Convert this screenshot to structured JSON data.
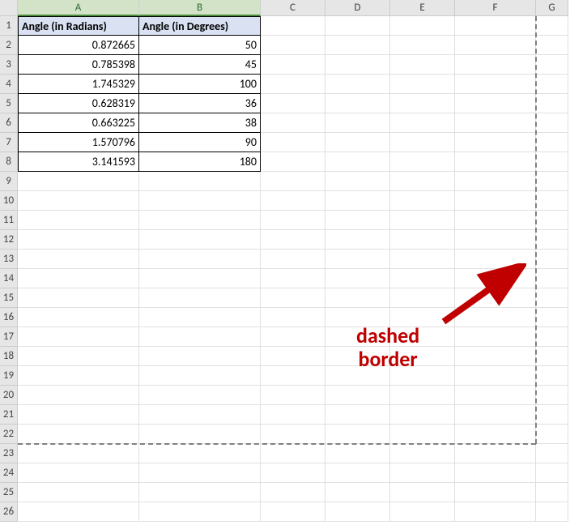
{
  "columns": [
    "A",
    "B",
    "C",
    "D",
    "E",
    "F",
    "G"
  ],
  "selectedCols": [
    "A",
    "B"
  ],
  "headerRow": {
    "A": "Angle (in Radians)",
    "B": "Angle (in Degrees)"
  },
  "dataRows": [
    {
      "A": "0.872665",
      "B": "50"
    },
    {
      "A": "0.785398",
      "B": "45"
    },
    {
      "A": "1.745329",
      "B": "100"
    },
    {
      "A": "0.628319",
      "B": "36"
    },
    {
      "A": "0.663225",
      "B": "38"
    },
    {
      "A": "1.570796",
      "B": "90"
    },
    {
      "A": "3.141593",
      "B": "180"
    }
  ],
  "totalRows": 26,
  "annotation": {
    "line1": "dashed",
    "line2": "border"
  }
}
